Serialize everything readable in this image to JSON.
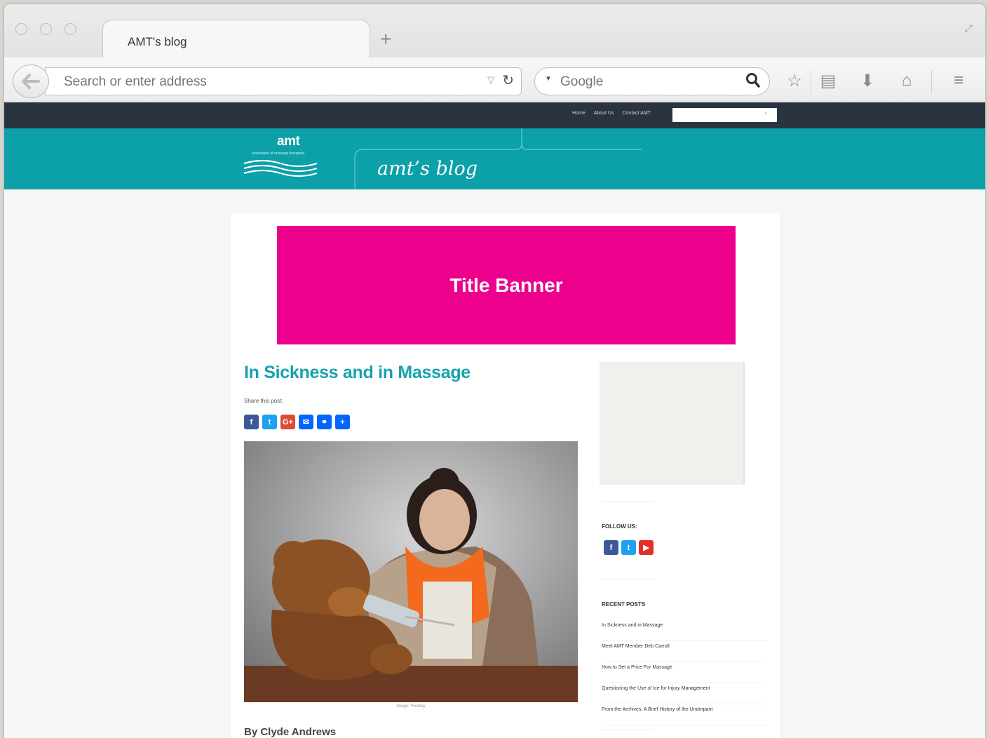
{
  "browser": {
    "tab_title": "AMT's blog",
    "new_tab_symbol": "+",
    "address_placeholder": "Search or enter address",
    "search_engine": "Google",
    "icons": [
      "back-arrow-icon",
      "dropdown-icon",
      "reload-icon",
      "search-icon",
      "star-icon",
      "reading-list-icon",
      "download-icon",
      "home-icon",
      "menu-icon"
    ]
  },
  "site": {
    "nav_links": [
      "Home",
      "About Us",
      "Contact AMT"
    ],
    "logo_text": "amt",
    "logo_subtitle": "association of massage therapists",
    "blog_name": "amt’s blog",
    "colors": {
      "topbar": "#2a3440",
      "header": "#0ca0a8",
      "banner": "#ec008c",
      "title": "#17a2ad"
    }
  },
  "post": {
    "banner_text": "Title Banner",
    "title": "In Sickness and in Massage",
    "share_label": "Share this post:",
    "share_buttons": [
      {
        "name": "facebook",
        "glyph": "f",
        "color": "#3b5998"
      },
      {
        "name": "twitter",
        "glyph": "t",
        "color": "#1da1f2"
      },
      {
        "name": "google-plus",
        "glyph": "G+",
        "color": "#dd4b39"
      },
      {
        "name": "email",
        "glyph": "✉",
        "color": "#0166ff"
      },
      {
        "name": "link",
        "glyph": "⚭",
        "color": "#0166ff"
      },
      {
        "name": "more",
        "glyph": "+",
        "color": "#0166ff"
      }
    ],
    "image_caption": "Image: Pixabay",
    "byline": "By Clyde Andrews"
  },
  "sidebar": {
    "follow_heading": "FOLLOW US:",
    "follow_buttons": [
      {
        "name": "facebook",
        "glyph": "f",
        "color": "#3b5998"
      },
      {
        "name": "twitter",
        "glyph": "t",
        "color": "#1da1f2"
      },
      {
        "name": "youtube",
        "glyph": "▶",
        "color": "#e52d27"
      }
    ],
    "recent_heading": "RECENT POSTS",
    "recent_posts": [
      "In Sickness and in Massage",
      "Meet AMT Member Deb Carroll",
      "How to Set a Price For Massage",
      "Questioning the Use of Ice for Injury Management",
      "From the Archives: A Brief History of the Underpant"
    ]
  }
}
